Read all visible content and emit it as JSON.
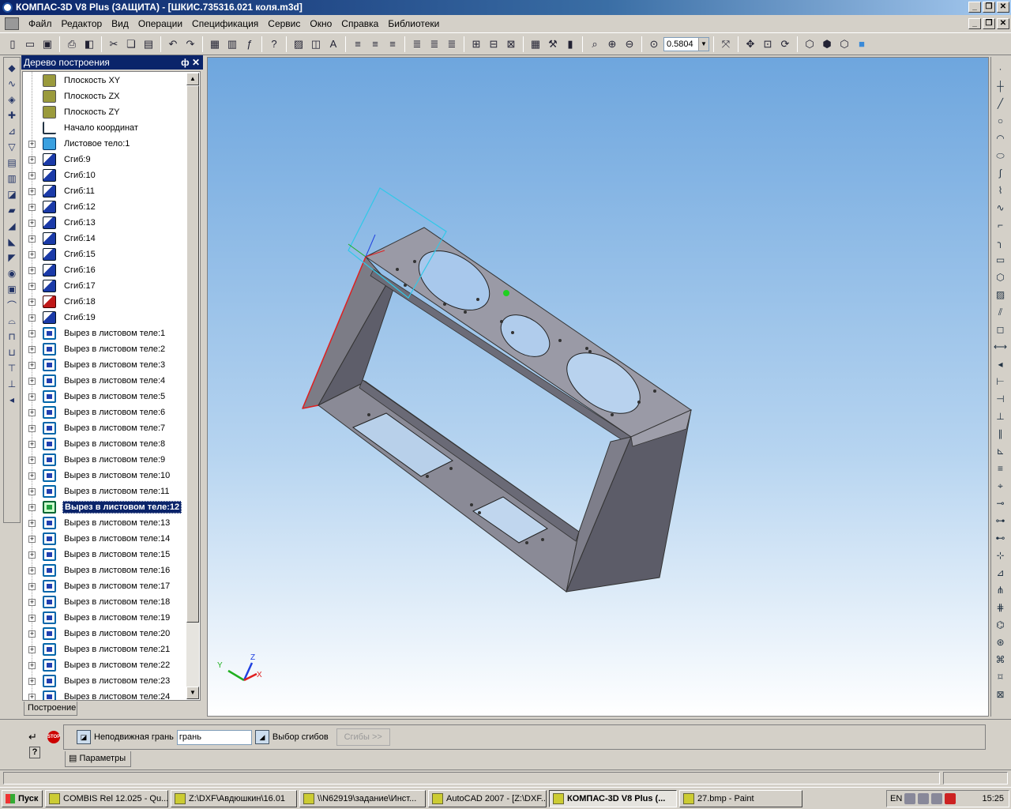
{
  "window": {
    "title": "КОМПАС-3D V8 Plus (ЗАЩИТА) - [ШКИС.735316.021 коля.m3d]",
    "min": "_",
    "restore": "❐",
    "close": "✕"
  },
  "menu": [
    "Файл",
    "Редактор",
    "Вид",
    "Операции",
    "Спецификация",
    "Сервис",
    "Окно",
    "Справка",
    "Библиотеки"
  ],
  "toolbar": {
    "zoom_value": "0.5804"
  },
  "panel": {
    "title": "Дерево построения",
    "pin": "ф",
    "close": "✕",
    "tab_label": "Построение"
  },
  "tree": {
    "items": [
      {
        "label": "Плоскость XY",
        "icon": "plane-icon",
        "expand": false
      },
      {
        "label": "Плоскость ZX",
        "icon": "plane-icon",
        "expand": false
      },
      {
        "label": "Плоскость ZY",
        "icon": "plane-icon",
        "expand": false
      },
      {
        "label": "Начало координат",
        "icon": "origin-icon",
        "expand": false
      },
      {
        "label": "Листовое тело:1",
        "icon": "sheet-body-icon",
        "expand": true
      },
      {
        "label": "Сгиб:9",
        "icon": "bend-icon",
        "expand": true
      },
      {
        "label": "Сгиб:10",
        "icon": "bend-icon",
        "expand": true
      },
      {
        "label": "Сгиб:11",
        "icon": "bend-icon",
        "expand": true
      },
      {
        "label": "Сгиб:12",
        "icon": "bend-icon",
        "expand": true
      },
      {
        "label": "Сгиб:13",
        "icon": "bend-icon",
        "expand": true
      },
      {
        "label": "Сгиб:14",
        "icon": "bend-icon",
        "expand": true
      },
      {
        "label": "Сгиб:15",
        "icon": "bend-icon",
        "expand": true
      },
      {
        "label": "Сгиб:16",
        "icon": "bend-icon",
        "expand": true
      },
      {
        "label": "Сгиб:17",
        "icon": "bend-icon",
        "expand": true
      },
      {
        "label": "Сгиб:18",
        "icon": "bend-red-icon",
        "expand": true
      },
      {
        "label": "Сгиб:19",
        "icon": "bend-icon",
        "expand": true
      },
      {
        "label": "Вырез в листовом теле:1",
        "icon": "cut-icon",
        "expand": true
      },
      {
        "label": "Вырез в листовом теле:2",
        "icon": "cut-icon",
        "expand": true
      },
      {
        "label": "Вырез в листовом теле:3",
        "icon": "cut-icon",
        "expand": true
      },
      {
        "label": "Вырез в листовом теле:4",
        "icon": "cut-icon",
        "expand": true
      },
      {
        "label": "Вырез в листовом теле:5",
        "icon": "cut-icon",
        "expand": true
      },
      {
        "label": "Вырез в листовом теле:6",
        "icon": "cut-icon",
        "expand": true
      },
      {
        "label": "Вырез в листовом теле:7",
        "icon": "cut-icon",
        "expand": true
      },
      {
        "label": "Вырез в листовом теле:8",
        "icon": "cut-icon",
        "expand": true
      },
      {
        "label": "Вырез в листовом теле:9",
        "icon": "cut-icon",
        "expand": true
      },
      {
        "label": "Вырез в листовом теле:10",
        "icon": "cut-icon",
        "expand": true
      },
      {
        "label": "Вырез в листовом теле:11",
        "icon": "cut-icon",
        "expand": true
      },
      {
        "label": "Вырез в листовом теле:12",
        "icon": "cut-selected-icon",
        "expand": true,
        "selected": true
      },
      {
        "label": "Вырез в листовом теле:13",
        "icon": "cut-icon",
        "expand": true
      },
      {
        "label": "Вырез в листовом теле:14",
        "icon": "cut-icon",
        "expand": true
      },
      {
        "label": "Вырез в листовом теле:15",
        "icon": "cut-icon",
        "expand": true
      },
      {
        "label": "Вырез в листовом теле:16",
        "icon": "cut-icon",
        "expand": true
      },
      {
        "label": "Вырез в листовом теле:17",
        "icon": "cut-icon",
        "expand": true
      },
      {
        "label": "Вырез в листовом теле:18",
        "icon": "cut-icon",
        "expand": true
      },
      {
        "label": "Вырез в листовом теле:19",
        "icon": "cut-icon",
        "expand": true
      },
      {
        "label": "Вырез в листовом теле:20",
        "icon": "cut-icon",
        "expand": true
      },
      {
        "label": "Вырез в листовом теле:21",
        "icon": "cut-icon",
        "expand": true
      },
      {
        "label": "Вырез в листовом теле:22",
        "icon": "cut-icon",
        "expand": true
      },
      {
        "label": "Вырез в листовом теле:23",
        "icon": "cut-icon",
        "expand": true
      },
      {
        "label": "Вырез в листовом теле:24",
        "icon": "cut-icon",
        "expand": true
      }
    ]
  },
  "viewport": {
    "axis_x": "X",
    "axis_y": "Y",
    "axis_z": "Z"
  },
  "properties": {
    "fixed_face_label": "Неподвижная грань",
    "fixed_face_value": "грань",
    "bend_select_label": "Выбор сгибов",
    "bends_button": "Сгибы  >>",
    "tab_label": "Параметры",
    "stop_label": "STOP",
    "help": "?"
  },
  "taskbar": {
    "start": "Пуск",
    "tasks": [
      {
        "label": "COMBIS Rel 12.025 - Qu...",
        "active": false
      },
      {
        "label": "Z:\\DXF\\Авдюшкин\\16.01",
        "active": false
      },
      {
        "label": "\\\\N62919\\задание\\Инст...",
        "active": false
      },
      {
        "label": "AutoCAD 2007 - [Z:\\DXF...",
        "active": false
      },
      {
        "label": "КОМПАС-3D V8 Plus (...",
        "active": true
      },
      {
        "label": "27.bmp - Paint",
        "active": false
      }
    ],
    "lang": "EN",
    "clock": "15:25"
  }
}
